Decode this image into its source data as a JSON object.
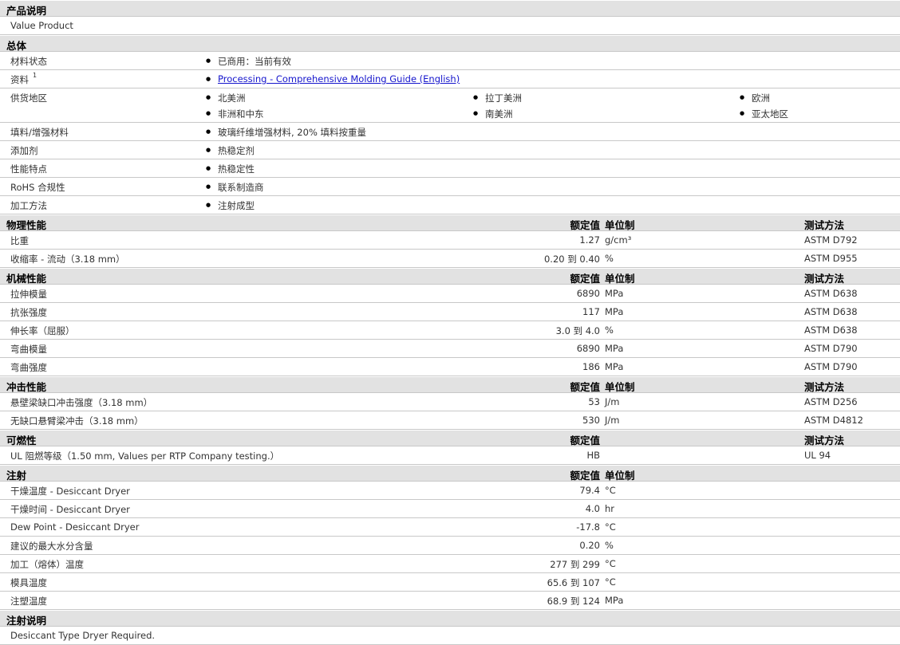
{
  "sections": [
    {
      "title": "产品说明",
      "rows": [
        {
          "label": "Value Product"
        }
      ]
    },
    {
      "title": "总体",
      "rows": [
        {
          "label": "材料状态",
          "items": [
            "已商用：当前有效"
          ]
        },
        {
          "label": "资料",
          "sup": "1",
          "link": "Processing - Comprehensive Molding Guide (English)"
        },
        {
          "label": "供货地区",
          "grid": [
            "北美洲",
            "拉丁美洲",
            "欧洲",
            "非洲和中东",
            "南美洲",
            "亚太地区"
          ]
        },
        {
          "label": "填料/增强材料",
          "items": [
            "玻璃纤维增强材料, 20% 填料按重量"
          ]
        },
        {
          "label": "添加剂",
          "items": [
            "热稳定剂"
          ]
        },
        {
          "label": "性能特点",
          "items": [
            "热稳定性"
          ]
        },
        {
          "label": "RoHS 合规性",
          "items": [
            "联系制造商"
          ]
        },
        {
          "label": "加工方法",
          "items": [
            "注射成型"
          ]
        }
      ]
    },
    {
      "title": "物理性能",
      "col_value": "额定值",
      "col_unit": "单位制",
      "col_test": "测试方法",
      "rows": [
        {
          "label": "比重",
          "value": "1.27",
          "unit": "g/cm³",
          "test": "ASTM D792"
        },
        {
          "label": "收缩率 - 流动（3.18 mm）",
          "value": "0.20 到 0.40",
          "unit": "%",
          "test": "ASTM D955"
        }
      ]
    },
    {
      "title": "机械性能",
      "col_value": "额定值",
      "col_unit": "单位制",
      "col_test": "测试方法",
      "rows": [
        {
          "label": "拉伸模量",
          "value": "6890",
          "unit": "MPa",
          "test": "ASTM D638"
        },
        {
          "label": "抗张强度",
          "value": "117",
          "unit": "MPa",
          "test": "ASTM D638"
        },
        {
          "label": "伸长率（屈服）",
          "value": "3.0 到 4.0",
          "unit": "%",
          "test": "ASTM D638"
        },
        {
          "label": "弯曲模量",
          "value": "6890",
          "unit": "MPa",
          "test": "ASTM D790"
        },
        {
          "label": "弯曲强度",
          "value": "186",
          "unit": "MPa",
          "test": "ASTM D790"
        }
      ]
    },
    {
      "title": "冲击性能",
      "col_value": "额定值",
      "col_unit": "单位制",
      "col_test": "测试方法",
      "rows": [
        {
          "label": "悬壁梁缺口冲击强度（3.18 mm）",
          "value": "53",
          "unit": "J/m",
          "test": "ASTM D256"
        },
        {
          "label": "无缺口悬臂梁冲击（3.18 mm）",
          "value": "530",
          "unit": "J/m",
          "test": "ASTM D4812"
        }
      ]
    },
    {
      "title": "可燃性",
      "col_value": "额定值",
      "col_test": "测试方法",
      "rows": [
        {
          "label": "UL 阻燃等级（1.50 mm, Values per RTP Company testing.）",
          "value": "HB",
          "test": "UL 94"
        }
      ]
    },
    {
      "title": "注射",
      "col_value": "额定值",
      "col_unit": "单位制",
      "rows": [
        {
          "label": "干燥温度 - Desiccant Dryer",
          "value": "79.4",
          "unit": "°C"
        },
        {
          "label": "干燥时间 - Desiccant Dryer",
          "value": "4.0",
          "unit": "hr"
        },
        {
          "label": "Dew Point - Desiccant Dryer",
          "value": "-17.8",
          "unit": "°C"
        },
        {
          "label": "建议的最大水分含量",
          "value": "0.20",
          "unit": "%"
        },
        {
          "label": "加工（熔体）温度",
          "value": "277 到 299",
          "unit": "°C"
        },
        {
          "label": "模具温度",
          "value": "65.6 到 107",
          "unit": "°C"
        },
        {
          "label": "注塑温度",
          "value": "68.9 到 124",
          "unit": "MPa"
        }
      ]
    },
    {
      "title": "注射说明",
      "rows": [
        {
          "label": "Desiccant Type Dryer Required."
        }
      ]
    }
  ]
}
